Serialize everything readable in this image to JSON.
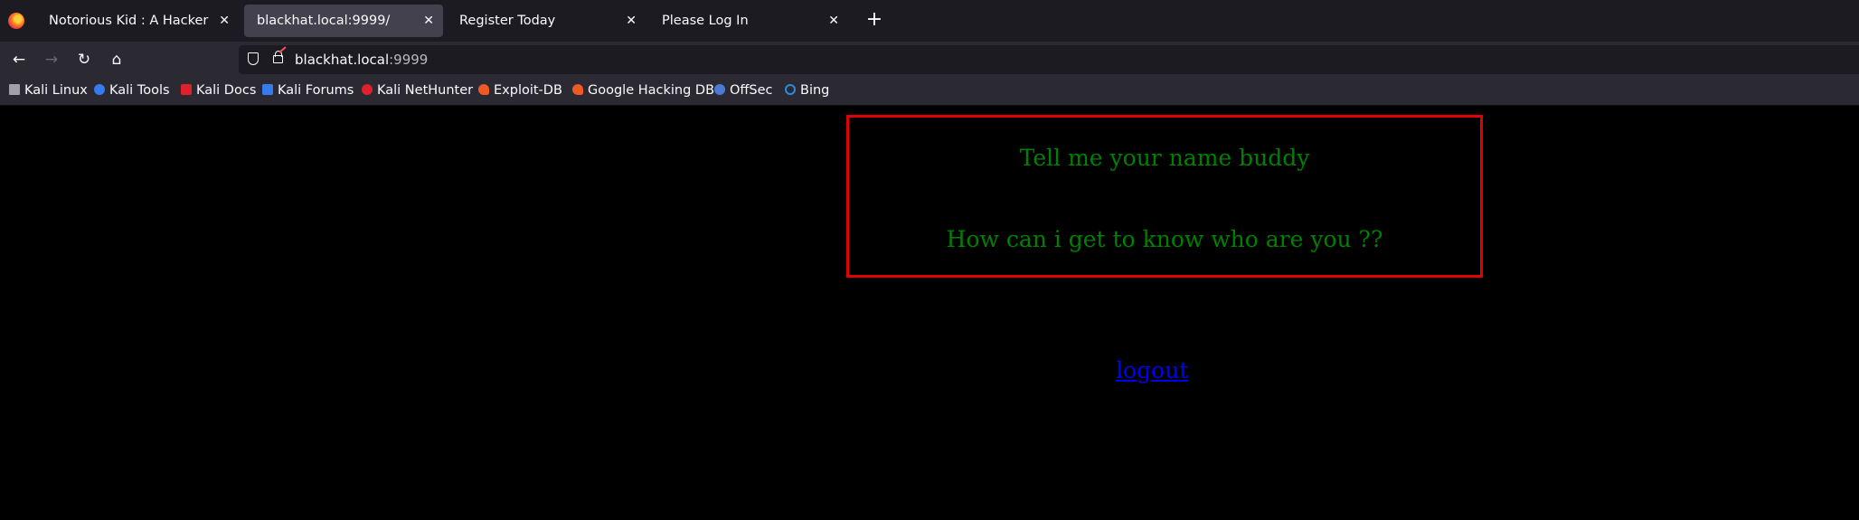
{
  "browser": {
    "tabs": [
      {
        "title": "Notorious Kid : A Hacker",
        "active": false
      },
      {
        "title": "blackhat.local:9999/",
        "active": true
      },
      {
        "title": "Register Today",
        "active": false
      },
      {
        "title": "Please Log In",
        "active": false
      }
    ],
    "new_tab_symbol": "+",
    "close_symbol": "✕",
    "nav": {
      "back": "←",
      "forward": "→",
      "reload": "↻",
      "home": "⌂"
    },
    "url_host": "blackhat.local",
    "url_port": ":9999",
    "bookmarks": [
      {
        "label": "Kali Linux",
        "icon": "kali-dragon-icon",
        "color": "#9ea3a8"
      },
      {
        "label": "Kali Tools",
        "icon": "kali-tools-icon",
        "color": "#367bf0"
      },
      {
        "label": "Kali Docs",
        "icon": "kali-docs-icon",
        "color": "#e0202a"
      },
      {
        "label": "Kali Forums",
        "icon": "kali-forums-icon",
        "color": "#367bf0"
      },
      {
        "label": "Kali NetHunter",
        "icon": "nethunter-icon",
        "color": "#e0202a"
      },
      {
        "label": "Exploit-DB",
        "icon": "exploit-db-icon",
        "color": "#ef5a24"
      },
      {
        "label": "Google Hacking DB",
        "icon": "ghdb-icon",
        "color": "#ef5a24"
      },
      {
        "label": "OffSec",
        "icon": "offsec-icon",
        "color": "#4b7bd6"
      },
      {
        "label": "Bing",
        "icon": "bing-search-icon",
        "color": "#2a8cde"
      }
    ]
  },
  "page": {
    "line1": "Tell me your name buddy",
    "line2": "How can i get to know who are you ??",
    "logout_label": "logout",
    "colors": {
      "text": "#008000",
      "border": "#e00000",
      "link": "#0000ee",
      "background": "#000000"
    }
  }
}
